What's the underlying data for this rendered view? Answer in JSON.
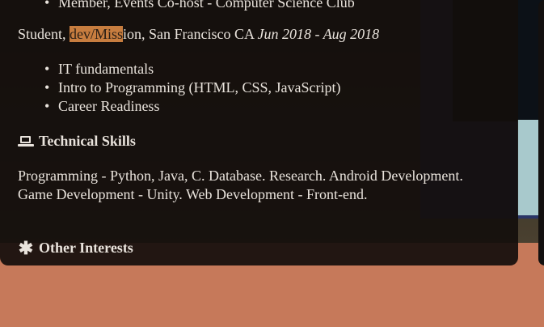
{
  "experience": {
    "cut_bullet": "Member, Events Co-host - Computer Science Club",
    "job_prefix": "Student, ",
    "job_highlight": "dev/Miss",
    "job_suffix": "ion, San Francisco CA ",
    "job_dates": "Jun 2018 - Aug 2018",
    "courses": [
      "IT fundamentals",
      "Intro to Programming (HTML, CSS, JavaScript)",
      "Career Readiness"
    ]
  },
  "skills": {
    "heading": "Technical Skills",
    "icon": "laptop-icon",
    "text": "Programming - Python, Java, C. Database. Research. Android Development. Game Development - Unity. Web Development - Front-end."
  },
  "interests": {
    "heading": "Other Interests",
    "icon": "asterisk-icon"
  },
  "colors": {
    "highlight": "#c77d3f",
    "card_bg": "#140e0c",
    "page_bg": "#c6795a"
  }
}
